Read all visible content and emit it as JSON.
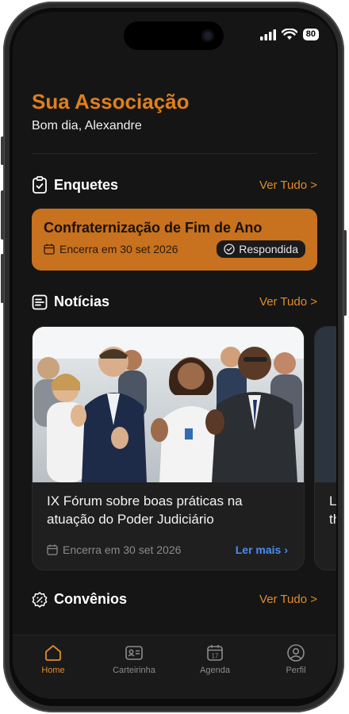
{
  "status": {
    "battery": "80"
  },
  "header": {
    "title": "Sua Associação",
    "greeting": "Bom dia, Alexandre"
  },
  "polls": {
    "title": "Enquetes",
    "see_all": "Ver Tudo >",
    "item": {
      "title": "Confraternização de Fim de Ano",
      "deadline": "Encerra em 30 set 2026",
      "badge": "Respondida"
    }
  },
  "news": {
    "title": "Notícias",
    "see_all": "Ver Tudo >",
    "items": [
      {
        "title": "IX Fórum sobre boas práticas na atuação do Poder Judiciário",
        "deadline": "Encerra em 30 set 2026",
        "read_more": "Ler mais"
      },
      {
        "title": "L\nth"
      }
    ]
  },
  "agreements": {
    "title": "Convênios",
    "see_all": "Ver Tudo >"
  },
  "nav": {
    "items": [
      {
        "label": "Home",
        "icon": "home-icon"
      },
      {
        "label": "Carteirinha",
        "icon": "id-card-icon"
      },
      {
        "label": "Agenda",
        "icon": "calendar-icon",
        "day": "17"
      },
      {
        "label": "Perfil",
        "icon": "profile-icon"
      }
    ]
  },
  "colors": {
    "accent": "#e07f1e",
    "link": "#4a8df0",
    "background": "#151515"
  }
}
